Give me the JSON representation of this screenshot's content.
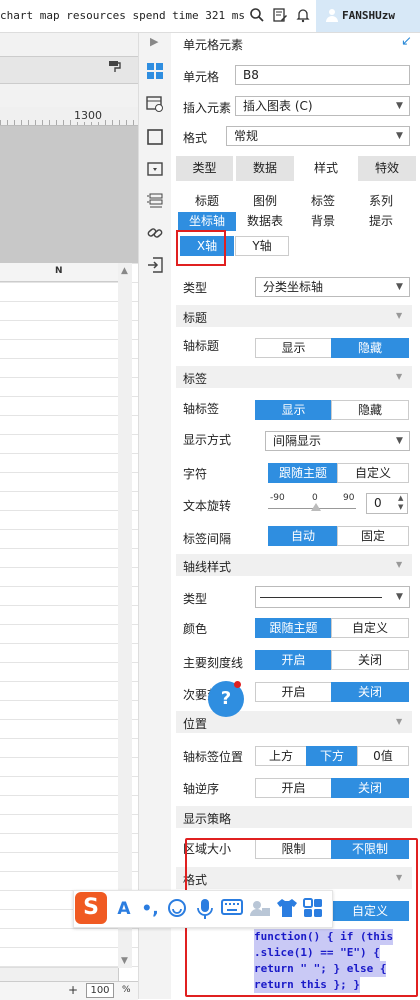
{
  "topbar": {
    "message": "chart map resources spend time 321 ms",
    "user": "FANSHUzw",
    "icons": [
      "search-icon",
      "edit-icon",
      "bell-icon",
      "user-icon"
    ]
  },
  "sheet": {
    "ruler_label": "1300",
    "column_label": "N",
    "zoom_plus": "+",
    "zoom_value": "100",
    "zoom_unit": "%"
  },
  "panel": {
    "title": "单元格元素",
    "cell_label": "单元格",
    "cell_value": "B8",
    "insert_label": "插入元素",
    "insert_value": "插入图表 (C)",
    "format_label": "格式",
    "format_value": "常规",
    "tabs": [
      "类型",
      "数据",
      "样式",
      "特效"
    ],
    "subtabs_row1": [
      "标题",
      "图例",
      "标签",
      "系列"
    ],
    "subtabs_row2": [
      "坐标轴",
      "数据表",
      "背景",
      "提示"
    ],
    "axis_tabs": [
      "X轴",
      "Y轴"
    ],
    "type_label": "类型",
    "type_value": "分类坐标轴",
    "sections": {
      "title": "标题",
      "label": "标签",
      "axis_style": "轴线样式",
      "position": "位置",
      "display_strategy": "显示策略",
      "format": "格式"
    },
    "axis_title_label": "轴标题",
    "axis_title_options": [
      "显示",
      "隐藏"
    ],
    "axis_label_label": "轴标签",
    "axis_label_options": [
      "显示",
      "隐藏"
    ],
    "display_mode_label": "显示方式",
    "display_mode_value": "间隔显示",
    "char_label": "字符",
    "char_options": [
      "跟随主题",
      "自定义"
    ],
    "rotate_label": "文本旋转",
    "rotate_ticks": [
      "-90",
      "0",
      "90"
    ],
    "rotate_value": "0",
    "label_interval_label": "标签间隔",
    "label_interval_options": [
      "自动",
      "固定"
    ],
    "line_type_label": "类型",
    "color_label": "颜色",
    "color_options": [
      "跟随主题",
      "自定义"
    ],
    "major_tick_label": "主要刻度线",
    "major_tick_options": [
      "开启",
      "关闭"
    ],
    "minor_tick_label": "次要刻度线",
    "minor_tick_options": [
      "开启",
      "关闭"
    ],
    "axis_pos_label": "轴标签位置",
    "axis_pos_options": [
      "上方",
      "下方",
      "0值"
    ],
    "reverse_label": "轴逆序",
    "reverse_options": [
      "开启",
      "关闭"
    ],
    "area_size_label": "区域大小",
    "area_size_options": [
      "限制",
      "不限制"
    ],
    "format_options": [
      "自定义"
    ],
    "code_lines": [
      "function() { if (this",
      ".slice(1) == \"E\") {",
      "return \" \"; } else {",
      "return this }; }"
    ]
  },
  "help": "?",
  "ime": {
    "logo": "S",
    "icons": [
      "font-icon",
      "punctuation-icon",
      "emoji-icon",
      "mic-icon",
      "keyboard-icon",
      "user-card-icon",
      "skin-icon",
      "grid-icon"
    ]
  },
  "colors": {
    "accent": "#2f8ee0",
    "highlight": "#e02020",
    "ime_logo": "#f05a22"
  }
}
